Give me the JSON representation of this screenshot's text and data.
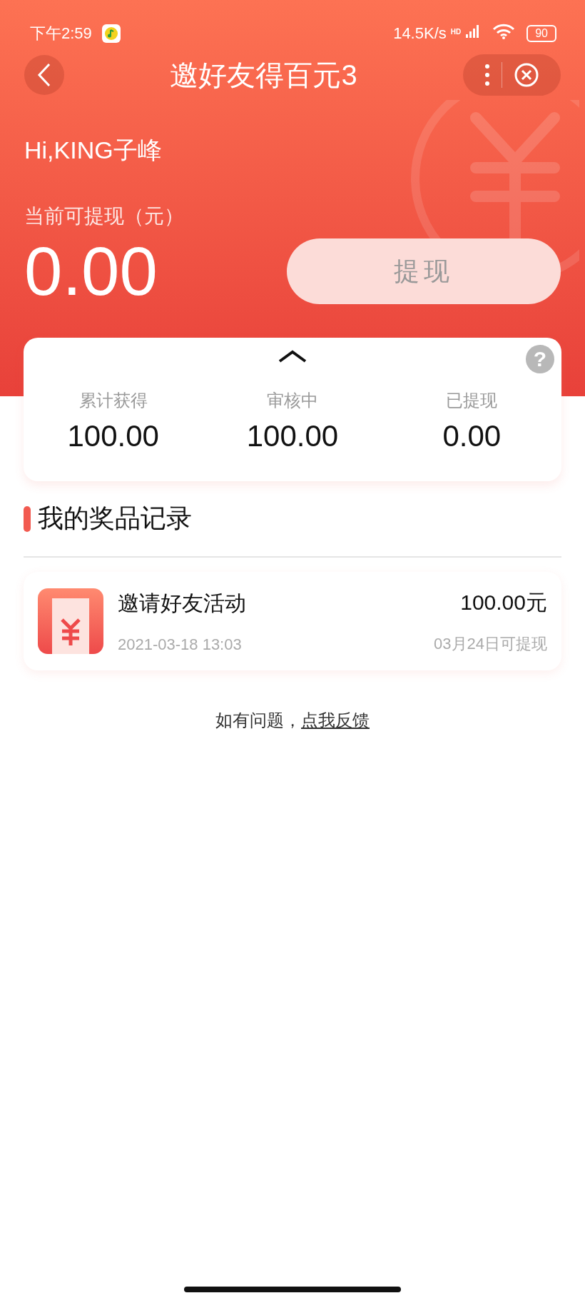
{
  "status_bar": {
    "time": "下午2:59",
    "net_speed": "14.5K/s",
    "network_badge": "HD",
    "battery": "90"
  },
  "nav": {
    "title": "邀好友得百元3"
  },
  "header": {
    "greeting": "Hi,KING子峰",
    "balance_label": "当前可提现（元）",
    "balance": "0.00",
    "withdraw_button": {
      "label": "提现",
      "disabled": true
    }
  },
  "stats": {
    "expanded": true,
    "help": "?",
    "items": [
      {
        "label": "累计获得",
        "value": "100.00"
      },
      {
        "label": "审核中",
        "value": "100.00"
      },
      {
        "label": "已提现",
        "value": "0.00"
      }
    ]
  },
  "section_title": "我的奖品记录",
  "records": [
    {
      "title": "邀请好友活动",
      "time": "2021-03-18 13:03",
      "amount": "100.00元",
      "note": "03月24日可提现"
    }
  ],
  "footer": {
    "text": "如有问题，",
    "link": "点我反馈"
  }
}
